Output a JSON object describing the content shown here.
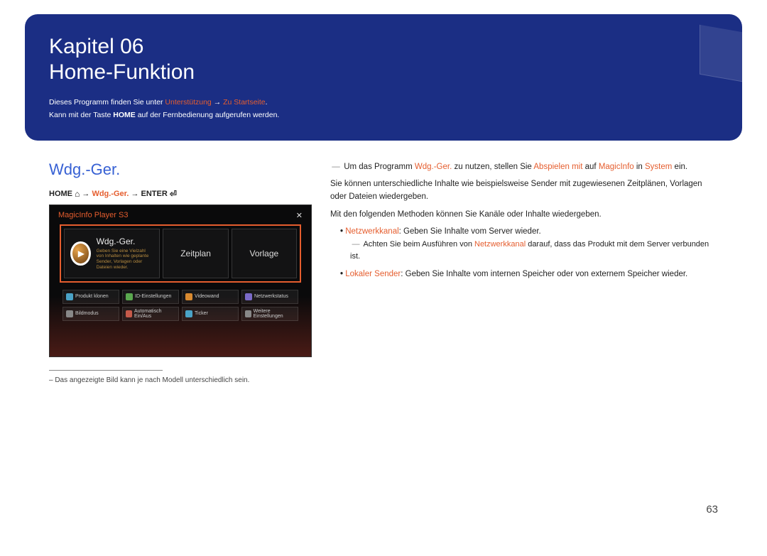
{
  "chapter_line1": "Kapitel 06",
  "chapter_line2": "Home-Funktion",
  "intro": {
    "pre": "Dieses Programm finden Sie unter ",
    "hl1": "Unterstützung",
    "arrow": " → ",
    "hl2": "Zu Startseite",
    "post": ".",
    "line2a": "Kann mit der Taste ",
    "line2b": "HOME",
    "line2c": " auf der Fernbedienung aufgerufen werden."
  },
  "section_title": "Wdg.-Ger.",
  "crumb": {
    "home": "HOME",
    "home_icon": "⌂",
    "arrow": " → ",
    "mid": "Wdg.-Ger.",
    "enter": "ENTER",
    "enter_icon": "⏎"
  },
  "shot": {
    "title": "MagicInfo Player S3",
    "close": "✕",
    "tile_main": "Wdg.-Ger.",
    "tile_main_sub": "Geben Sie eine Vielzahl von Inhalten wie geplante Sender, Vorlagen oder Dateien wieder.",
    "tile_side1": "Zeitplan",
    "tile_side2": "Vorlage",
    "grid": [
      [
        "Produkt klonen",
        "ID-Einstellungen",
        "Videowand",
        "Netzwerkstatus"
      ],
      [
        "Bildmodus",
        "Automatisch Ein/Aus",
        "Ticker",
        "Weitere Einstellungen"
      ]
    ]
  },
  "footnote": "– Das angezeigte Bild kann je nach Modell unterschiedlich sein.",
  "body": {
    "p1a": "Um das Programm ",
    "p1b": "Wdg.-Ger.",
    "p1c": " zu nutzen, stellen Sie ",
    "p1d": "Abspielen mit",
    "p1e": " auf ",
    "p1f": "MagicInfo",
    "p1g": " in ",
    "p1h": "System",
    "p1i": " ein.",
    "p2": "Sie können unterschiedliche Inhalte wie beispielsweise Sender mit zugewiesenen Zeitplänen, Vorlagen oder Dateien wiedergeben.",
    "p3": "Mit den folgenden Methoden können Sie Kanäle oder Inhalte wiedergeben.",
    "li1a": "Netzwerkkanal",
    "li1b": ": Geben Sie Inhalte vom Server wieder.",
    "sub1a": "Achten Sie beim Ausführen von ",
    "sub1b": "Netzwerkkanal",
    "sub1c": " darauf, dass das Produkt mit dem Server verbunden ist.",
    "li2a": "Lokaler Sender",
    "li2b": ": Geben Sie Inhalte vom internen Speicher oder von externem Speicher wieder."
  },
  "page_number": "63"
}
